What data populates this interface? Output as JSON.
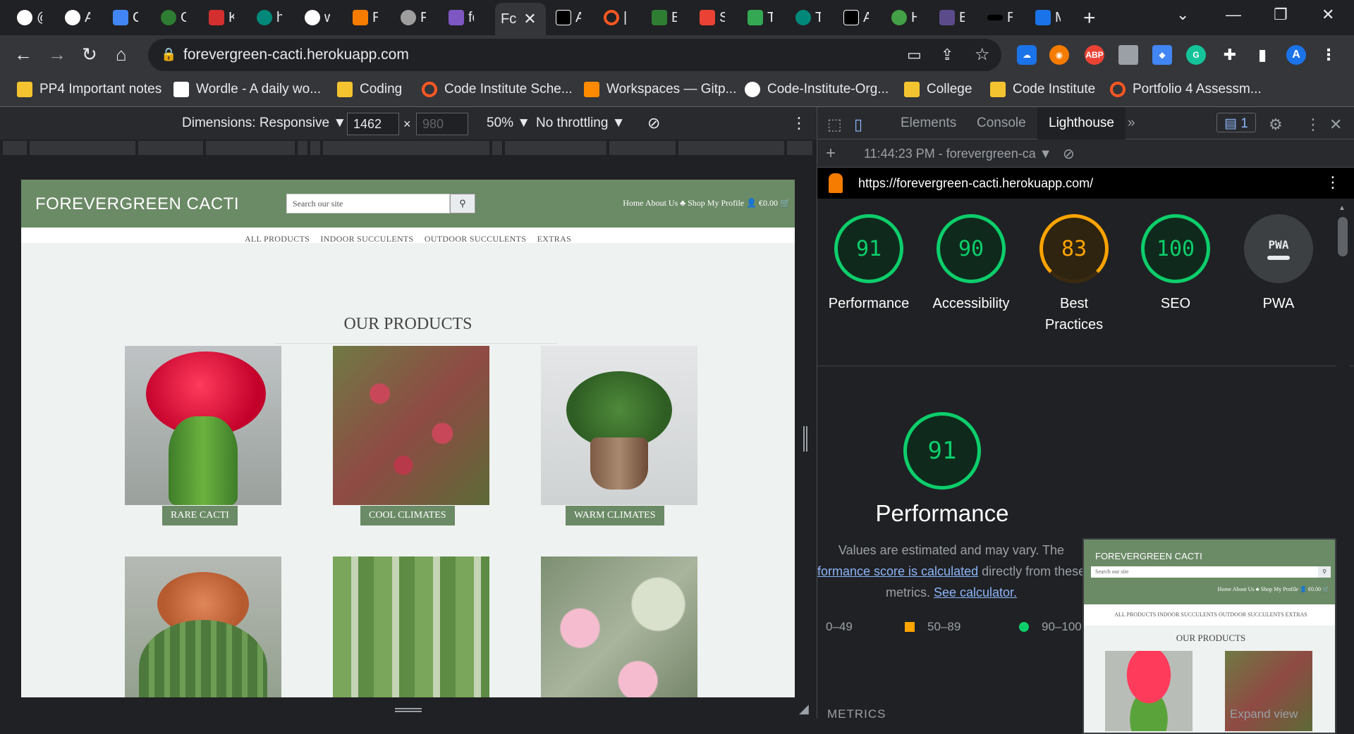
{
  "browser": {
    "tabs": [
      {
        "label": "@",
        "color": "#ffffff"
      },
      {
        "label": "A",
        "color": "#ffffff"
      },
      {
        "label": "C",
        "color": "#4285f4"
      },
      {
        "label": "G",
        "color": "#2e7d32"
      },
      {
        "label": "K",
        "color": "#d32f2f"
      },
      {
        "label": "h",
        "color": "#00897b"
      },
      {
        "label": "w",
        "color": "#ffffff"
      },
      {
        "label": "R",
        "color": "#f57c00"
      },
      {
        "label": "F",
        "color": "#9e9e9e"
      },
      {
        "label": "fc",
        "color": "#7e57c2"
      },
      {
        "label": "Fc",
        "color": "#35363a",
        "active": true
      },
      {
        "label": "A",
        "color": "#000000"
      },
      {
        "label": "|",
        "color": "#ff5722"
      },
      {
        "label": "B",
        "color": "#2e7d32"
      },
      {
        "label": "S",
        "color": "#ea4335"
      },
      {
        "label": "T",
        "color": "#34a853"
      },
      {
        "label": "T",
        "color": "#00897b"
      },
      {
        "label": "A",
        "color": "#000000"
      },
      {
        "label": "H",
        "color": "#43a047"
      },
      {
        "label": "B",
        "color": "#5c4b8a"
      },
      {
        "label": "R",
        "color": "#000000"
      },
      {
        "label": "M",
        "color": "#1a73e8"
      }
    ],
    "url": "forevergreen-cacti.herokuapp.com",
    "bookmarks": [
      {
        "label": "PP4 Important notes",
        "color": "#f4c430"
      },
      {
        "label": "Wordle - A daily wo...",
        "color": "#ffffff"
      },
      {
        "label": "Coding",
        "color": "#f4c430"
      },
      {
        "label": "Code Institute Sche...",
        "color": "#ff5722"
      },
      {
        "label": "Workspaces — Gitp...",
        "color": "#ff8a00"
      },
      {
        "label": "Code-Institute-Org...",
        "color": "#ffffff"
      },
      {
        "label": "College",
        "color": "#f4c430"
      },
      {
        "label": "Code Institute",
        "color": "#f4c430"
      },
      {
        "label": "Portfolio 4 Assessm...",
        "color": "#ff5722"
      }
    ]
  },
  "device_toolbar": {
    "dimensions_label": "Dimensions: Responsive ▼",
    "width": "1462",
    "height_placeholder": "980",
    "zoom": "50% ▼",
    "throttling": "No throttling ▼"
  },
  "site": {
    "brand": "FOREVERGREEN CACTI",
    "search_placeholder": "Search our site",
    "nav": "Home  About Us ♣  Shop  My Profile 👤  €0.00 🛒",
    "subnav": [
      "ALL PRODUCTS",
      "INDOOR SUCCULENTS",
      "OUTDOOR SUCCULENTS",
      "EXTRAS"
    ],
    "products_title": "OUR PRODUCTS",
    "categories": [
      "RARE CACTI",
      "COOL CLIMATES",
      "WARM CLIMATES"
    ]
  },
  "devtools": {
    "tabs": [
      "Elements",
      "Console",
      "Lighthouse"
    ],
    "issues_count": "1",
    "report_time": "11:44:23 PM - forevergreen-ca ▼",
    "report_url": "https://forevergreen-cacti.herokuapp.com/",
    "scores": [
      {
        "label": "Performance",
        "value": "91",
        "color": "#0cce6b"
      },
      {
        "label": "Accessibility",
        "value": "90",
        "color": "#0cce6b"
      },
      {
        "label": "Best Practices",
        "value": "83",
        "color": "#ffa400"
      },
      {
        "label": "SEO",
        "value": "100",
        "color": "#0cce6b"
      },
      {
        "label": "PWA",
        "value": "PWA",
        "color": "#9aa0a6"
      }
    ],
    "perf": {
      "value": "91",
      "title": "Performance",
      "desc_1": "Values are estimated and may vary. The",
      "desc_link": "formance score is calculated",
      "desc_2": " directly from these",
      "desc_3": "metrics. ",
      "calc_link": "See calculator."
    },
    "legend": {
      "low": "0–49",
      "mid": "50–89",
      "high": "90–100"
    },
    "metrics_label": "METRICS",
    "expand_label": "Expand view",
    "thumb": {
      "brand": "FOREVERGREEN CACTI",
      "search": "Search our site",
      "nav": "Home   About Us ♣   Shop   My Profile 👤   €0.00 🛒",
      "subnav": "ALL PRODUCTS   INDOOR SUCCULENTS   OUTDOOR SUCCULENTS   EXTRAS",
      "title": "OUR PRODUCTS"
    }
  }
}
